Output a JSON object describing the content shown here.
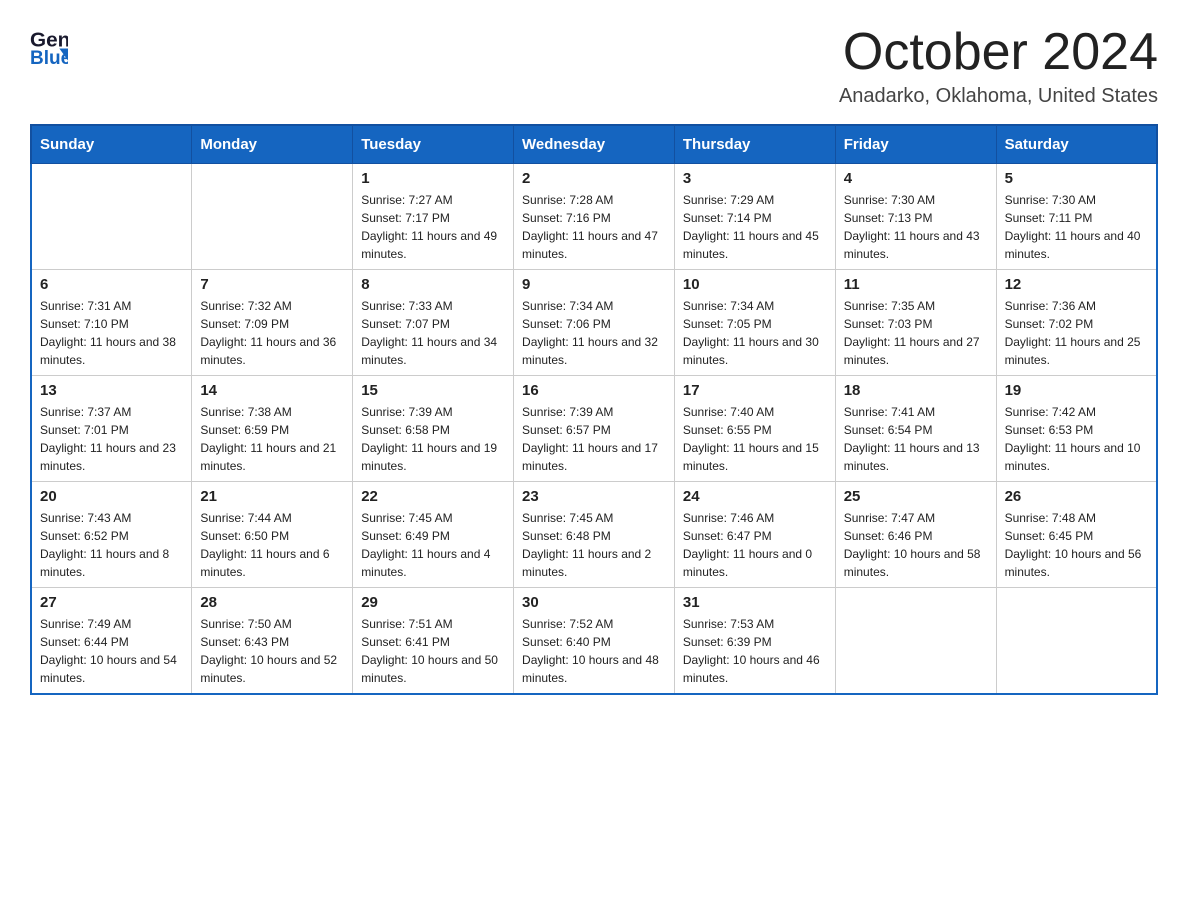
{
  "logo": {
    "line1": "General",
    "arrow": "▶",
    "line2": "Blue"
  },
  "title": "October 2024",
  "location": "Anadarko, Oklahoma, United States",
  "days_of_week": [
    "Sunday",
    "Monday",
    "Tuesday",
    "Wednesday",
    "Thursday",
    "Friday",
    "Saturday"
  ],
  "weeks": [
    [
      {
        "num": "",
        "sunrise": "",
        "sunset": "",
        "daylight": ""
      },
      {
        "num": "",
        "sunrise": "",
        "sunset": "",
        "daylight": ""
      },
      {
        "num": "1",
        "sunrise": "Sunrise: 7:27 AM",
        "sunset": "Sunset: 7:17 PM",
        "daylight": "Daylight: 11 hours and 49 minutes."
      },
      {
        "num": "2",
        "sunrise": "Sunrise: 7:28 AM",
        "sunset": "Sunset: 7:16 PM",
        "daylight": "Daylight: 11 hours and 47 minutes."
      },
      {
        "num": "3",
        "sunrise": "Sunrise: 7:29 AM",
        "sunset": "Sunset: 7:14 PM",
        "daylight": "Daylight: 11 hours and 45 minutes."
      },
      {
        "num": "4",
        "sunrise": "Sunrise: 7:30 AM",
        "sunset": "Sunset: 7:13 PM",
        "daylight": "Daylight: 11 hours and 43 minutes."
      },
      {
        "num": "5",
        "sunrise": "Sunrise: 7:30 AM",
        "sunset": "Sunset: 7:11 PM",
        "daylight": "Daylight: 11 hours and 40 minutes."
      }
    ],
    [
      {
        "num": "6",
        "sunrise": "Sunrise: 7:31 AM",
        "sunset": "Sunset: 7:10 PM",
        "daylight": "Daylight: 11 hours and 38 minutes."
      },
      {
        "num": "7",
        "sunrise": "Sunrise: 7:32 AM",
        "sunset": "Sunset: 7:09 PM",
        "daylight": "Daylight: 11 hours and 36 minutes."
      },
      {
        "num": "8",
        "sunrise": "Sunrise: 7:33 AM",
        "sunset": "Sunset: 7:07 PM",
        "daylight": "Daylight: 11 hours and 34 minutes."
      },
      {
        "num": "9",
        "sunrise": "Sunrise: 7:34 AM",
        "sunset": "Sunset: 7:06 PM",
        "daylight": "Daylight: 11 hours and 32 minutes."
      },
      {
        "num": "10",
        "sunrise": "Sunrise: 7:34 AM",
        "sunset": "Sunset: 7:05 PM",
        "daylight": "Daylight: 11 hours and 30 minutes."
      },
      {
        "num": "11",
        "sunrise": "Sunrise: 7:35 AM",
        "sunset": "Sunset: 7:03 PM",
        "daylight": "Daylight: 11 hours and 27 minutes."
      },
      {
        "num": "12",
        "sunrise": "Sunrise: 7:36 AM",
        "sunset": "Sunset: 7:02 PM",
        "daylight": "Daylight: 11 hours and 25 minutes."
      }
    ],
    [
      {
        "num": "13",
        "sunrise": "Sunrise: 7:37 AM",
        "sunset": "Sunset: 7:01 PM",
        "daylight": "Daylight: 11 hours and 23 minutes."
      },
      {
        "num": "14",
        "sunrise": "Sunrise: 7:38 AM",
        "sunset": "Sunset: 6:59 PM",
        "daylight": "Daylight: 11 hours and 21 minutes."
      },
      {
        "num": "15",
        "sunrise": "Sunrise: 7:39 AM",
        "sunset": "Sunset: 6:58 PM",
        "daylight": "Daylight: 11 hours and 19 minutes."
      },
      {
        "num": "16",
        "sunrise": "Sunrise: 7:39 AM",
        "sunset": "Sunset: 6:57 PM",
        "daylight": "Daylight: 11 hours and 17 minutes."
      },
      {
        "num": "17",
        "sunrise": "Sunrise: 7:40 AM",
        "sunset": "Sunset: 6:55 PM",
        "daylight": "Daylight: 11 hours and 15 minutes."
      },
      {
        "num": "18",
        "sunrise": "Sunrise: 7:41 AM",
        "sunset": "Sunset: 6:54 PM",
        "daylight": "Daylight: 11 hours and 13 minutes."
      },
      {
        "num": "19",
        "sunrise": "Sunrise: 7:42 AM",
        "sunset": "Sunset: 6:53 PM",
        "daylight": "Daylight: 11 hours and 10 minutes."
      }
    ],
    [
      {
        "num": "20",
        "sunrise": "Sunrise: 7:43 AM",
        "sunset": "Sunset: 6:52 PM",
        "daylight": "Daylight: 11 hours and 8 minutes."
      },
      {
        "num": "21",
        "sunrise": "Sunrise: 7:44 AM",
        "sunset": "Sunset: 6:50 PM",
        "daylight": "Daylight: 11 hours and 6 minutes."
      },
      {
        "num": "22",
        "sunrise": "Sunrise: 7:45 AM",
        "sunset": "Sunset: 6:49 PM",
        "daylight": "Daylight: 11 hours and 4 minutes."
      },
      {
        "num": "23",
        "sunrise": "Sunrise: 7:45 AM",
        "sunset": "Sunset: 6:48 PM",
        "daylight": "Daylight: 11 hours and 2 minutes."
      },
      {
        "num": "24",
        "sunrise": "Sunrise: 7:46 AM",
        "sunset": "Sunset: 6:47 PM",
        "daylight": "Daylight: 11 hours and 0 minutes."
      },
      {
        "num": "25",
        "sunrise": "Sunrise: 7:47 AM",
        "sunset": "Sunset: 6:46 PM",
        "daylight": "Daylight: 10 hours and 58 minutes."
      },
      {
        "num": "26",
        "sunrise": "Sunrise: 7:48 AM",
        "sunset": "Sunset: 6:45 PM",
        "daylight": "Daylight: 10 hours and 56 minutes."
      }
    ],
    [
      {
        "num": "27",
        "sunrise": "Sunrise: 7:49 AM",
        "sunset": "Sunset: 6:44 PM",
        "daylight": "Daylight: 10 hours and 54 minutes."
      },
      {
        "num": "28",
        "sunrise": "Sunrise: 7:50 AM",
        "sunset": "Sunset: 6:43 PM",
        "daylight": "Daylight: 10 hours and 52 minutes."
      },
      {
        "num": "29",
        "sunrise": "Sunrise: 7:51 AM",
        "sunset": "Sunset: 6:41 PM",
        "daylight": "Daylight: 10 hours and 50 minutes."
      },
      {
        "num": "30",
        "sunrise": "Sunrise: 7:52 AM",
        "sunset": "Sunset: 6:40 PM",
        "daylight": "Daylight: 10 hours and 48 minutes."
      },
      {
        "num": "31",
        "sunrise": "Sunrise: 7:53 AM",
        "sunset": "Sunset: 6:39 PM",
        "daylight": "Daylight: 10 hours and 46 minutes."
      },
      {
        "num": "",
        "sunrise": "",
        "sunset": "",
        "daylight": ""
      },
      {
        "num": "",
        "sunrise": "",
        "sunset": "",
        "daylight": ""
      }
    ]
  ]
}
